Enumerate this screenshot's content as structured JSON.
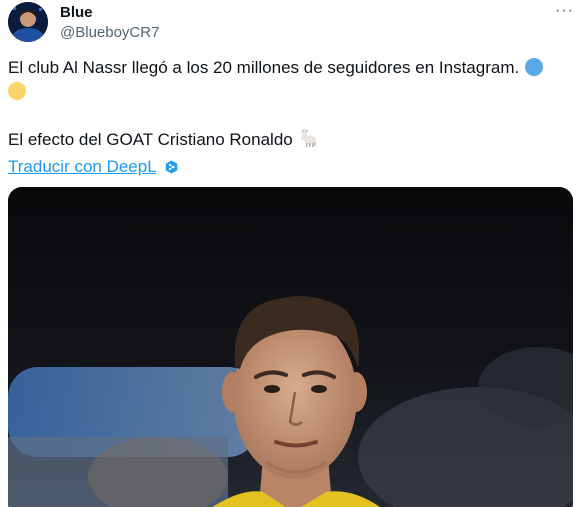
{
  "tweet": {
    "author_name": "Blue",
    "author_handle": "@BlueboyCR7",
    "more_icon": "more-options-icon",
    "text_line1": "El club Al Nassr llegó a los 20 millones de seguidores en Instagram.",
    "text_line3": "El efecto del GOAT Cristiano Ronaldo",
    "emoji": {
      "blue_circle": "blue-circle-emoji",
      "yellow_circle": "yellow-circle-emoji",
      "goat": "goat-emoji"
    },
    "translate_label": "Traducir con DeepL",
    "translate_icon": "deepl-icon",
    "media_alt": "photo"
  },
  "colors": {
    "link": "#1d9bf0",
    "text": "#0f1419",
    "secondary": "#536471",
    "blue_dot": "#5aa9e6",
    "yellow_dot": "#fcd26a"
  }
}
